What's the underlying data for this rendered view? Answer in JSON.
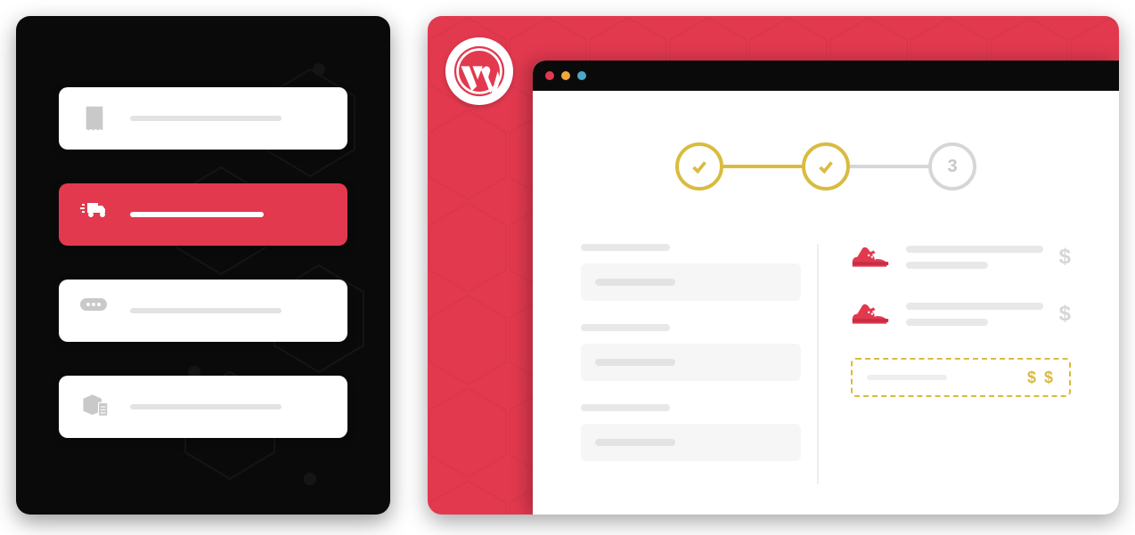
{
  "sidebar": {
    "items": [
      {
        "icon": "receipt-icon",
        "active": false
      },
      {
        "icon": "fast-delivery-icon",
        "active": true
      },
      {
        "icon": "chat-icon",
        "active": false
      },
      {
        "icon": "inventory-icon",
        "active": false
      }
    ]
  },
  "platform": {
    "logo": "wordpress"
  },
  "window": {
    "traffic_lights": [
      "red",
      "amber",
      "teal"
    ]
  },
  "checkout": {
    "steps": [
      {
        "state": "done",
        "label": ""
      },
      {
        "state": "done",
        "label": ""
      },
      {
        "state": "pending",
        "label": "3"
      }
    ],
    "form_fields": 3,
    "cart_items": [
      {
        "product": "sneaker",
        "price_symbol": "$"
      },
      {
        "product": "sneaker",
        "price_symbol": "$"
      }
    ],
    "total": {
      "price_symbol": "$ $"
    }
  },
  "colors": {
    "brand_red": "#e2394f",
    "accent_gold": "#d9bb3f",
    "panel_black": "#0a0a0a"
  }
}
